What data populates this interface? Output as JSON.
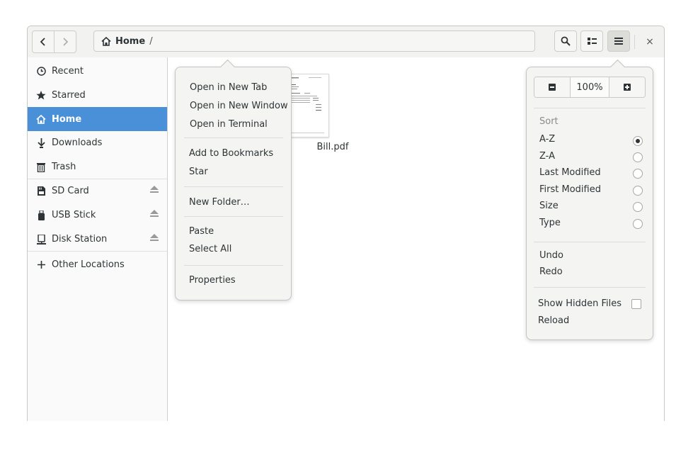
{
  "window": {
    "title": "Home"
  },
  "pathbar": {
    "home_label": "Home",
    "separator": "/"
  },
  "header": {
    "back_icon": "chevron-left-icon",
    "forward_icon": "chevron-right-icon",
    "search_icon": "search-icon",
    "view_icon": "list-view-icon",
    "menu_icon": "hamburger-icon",
    "close_label": "×"
  },
  "sidebar": {
    "items": [
      {
        "label": "Recent",
        "icon": "clock-icon"
      },
      {
        "label": "Starred",
        "icon": "star-icon"
      },
      {
        "label": "Home",
        "icon": "home-icon",
        "selected": true
      },
      {
        "label": "Downloads",
        "icon": "download-icon"
      },
      {
        "label": "Trash",
        "icon": "trash-icon"
      },
      {
        "label": "SD Card",
        "icon": "sd-card-icon",
        "ejectable": true
      },
      {
        "label": "USB Stick",
        "icon": "usb-icon",
        "ejectable": true
      },
      {
        "label": "Disk Station",
        "icon": "disk-station-icon",
        "ejectable": true
      },
      {
        "label": "Other Locations",
        "icon": "plus-icon"
      }
    ]
  },
  "files": [
    {
      "name": "Bill.pdf"
    }
  ],
  "context_menu": {
    "items": [
      "Open in New Tab",
      "Open in New Window",
      "Open in Terminal",
      "Add to Bookmarks",
      "Star",
      "New Folder…",
      "Paste",
      "Select All",
      "Properties"
    ]
  },
  "view_menu": {
    "zoom": "100%",
    "sort_heading": "Sort",
    "sort_options": [
      "A-Z",
      "Z-A",
      "Last Modified",
      "First Modified",
      "Size",
      "Type"
    ],
    "sort_selected": "A-Z",
    "undo": "Undo",
    "redo": "Redo",
    "show_hidden": "Show Hidden Files",
    "show_hidden_checked": false,
    "reload": "Reload"
  },
  "colors": {
    "accent": "#4a90d9",
    "text": "#2e3436"
  }
}
